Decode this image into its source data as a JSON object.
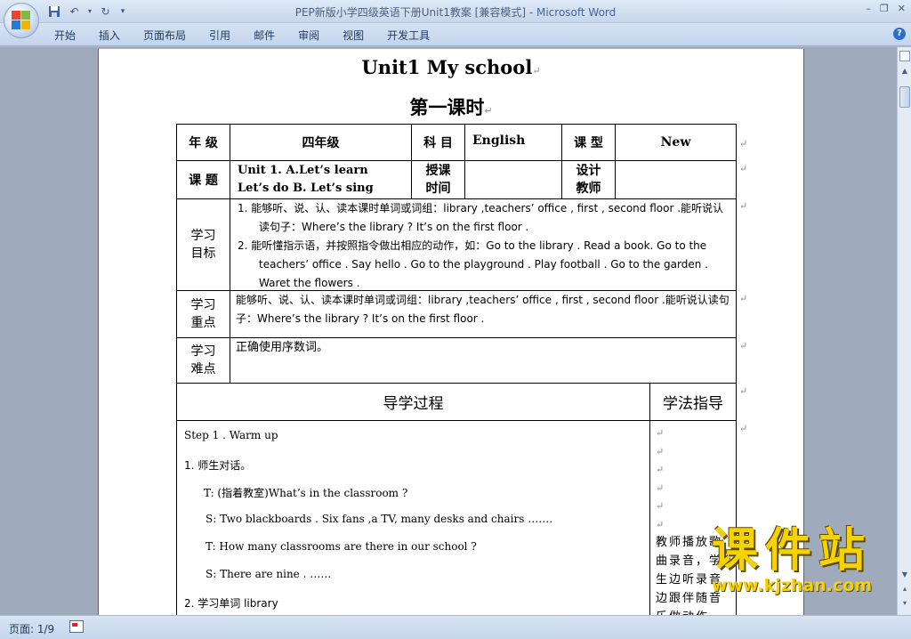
{
  "window": {
    "title": "PEP新版小学四级英语下册Unit1教案 [兼容模式] - ",
    "app_name": "Microsoft Word"
  },
  "quick_access": {
    "save_icon": "save-icon",
    "undo_icon": "undo-icon",
    "redo_icon": "redo-icon"
  },
  "ribbon": {
    "tabs": [
      "开始",
      "插入",
      "页面布局",
      "引用",
      "邮件",
      "审阅",
      "视图",
      "开发工具"
    ]
  },
  "document": {
    "title": "Unit1 My school",
    "subtitle": "第一课时",
    "info": {
      "grade_label": "年 级",
      "grade_value": "四年级",
      "subject_label": "科 目",
      "subject_value": "English",
      "type_label": "课 型",
      "type_value": "New",
      "topic_label": "课 题",
      "topic_line1": "Unit 1.    A.Let’s learn",
      "topic_line2": "Let’s do    B. Let’s sing",
      "time_label": "授课时间",
      "designer_label": "设计教师"
    },
    "goals": {
      "label": "学习目标",
      "item1": "1.   能够听、说、认、读本课时单词或词组：library ,teachers’ office , first , second floor .能听说认读句子：Where’s the library ? It’s on the first floor .",
      "item2": "2.   能听懂指示语，并按照指令做出相应的动作，如：Go to the library . Read a book. Go to the teachers’ office . Say hello . Go to the playground . Play football . Go to the garden . Waret the flowers ."
    },
    "key_points": {
      "label": "学习重点",
      "text": "能够听、说、认、读本课时单词或词组：library ,teachers’ office , first , second floor .能听说认读句子：Where’s the library ? It’s on the first floor ."
    },
    "difficulties": {
      "label": "学习难点",
      "text": "正确使用序数词。"
    },
    "process": {
      "header": "导学过程",
      "method_header": "学法指导",
      "lines": [
        "Step 1 . Warm up",
        "1.  师生对话。",
        "T: (指着教室)What’s in the classroom ?",
        "S: Two blackboards . Six fans ,a TV, many desks and chairs …….",
        "T: How many classrooms are there in our school ?",
        "S: There are nine    .    ……",
        "2.  学习单词 library"
      ],
      "method_text": "教师播放歌曲录音，学生边听录音边跟伴随音乐做动作。"
    }
  },
  "status": {
    "page": "页面: 1/9"
  },
  "watermark": {
    "title": "课件站",
    "url": "www.kjzhan.com"
  }
}
